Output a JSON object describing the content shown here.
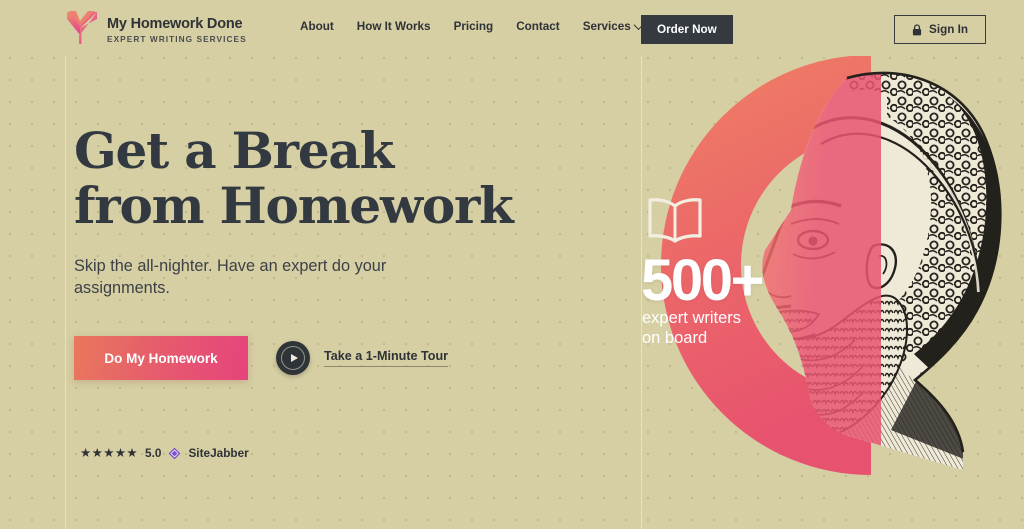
{
  "brand": {
    "name": "My Homework Done",
    "tagline": "EXPERT WRITING SERVICES",
    "logo_icon": "book-checkmark-logo-icon",
    "accent_start": "#e8785c",
    "accent_end": "#e6447c"
  },
  "nav": {
    "items": [
      {
        "label": "About",
        "has_dropdown": false
      },
      {
        "label": "How It Works",
        "has_dropdown": false
      },
      {
        "label": "Pricing",
        "has_dropdown": false
      },
      {
        "label": "Contact",
        "has_dropdown": false
      },
      {
        "label": "Services",
        "has_dropdown": true
      }
    ]
  },
  "header": {
    "order_label": "Order Now",
    "signin_label": "Sign In",
    "signin_icon": "lock-icon",
    "order_bg": "#343a40"
  },
  "hero": {
    "headline": "Get a Break\nfrom Homework",
    "subhead": "Skip the all-nighter. Have an expert do your assignments.",
    "cta_label": "Do My Homework",
    "tour_label": "Take a 1-Minute Tour",
    "play_icon": "play-circle-icon",
    "rating": {
      "stars": "★★★★★",
      "score": "5.0",
      "source": "SiteJabber",
      "source_icon": "sitejabber-badge-icon"
    }
  },
  "promo": {
    "book_icon": "open-book-icon",
    "stat_number": "500+",
    "stat_label": "expert writers\non board",
    "arc_icon": "coral-arc-graphic",
    "portrait_icon": "greek-philosopher-portrait",
    "arc_color_top": "#ee7f64",
    "arc_color_bottom": "#e85570"
  },
  "theme": {
    "background": "#d5cfa3",
    "text_dark": "#2f3237"
  }
}
